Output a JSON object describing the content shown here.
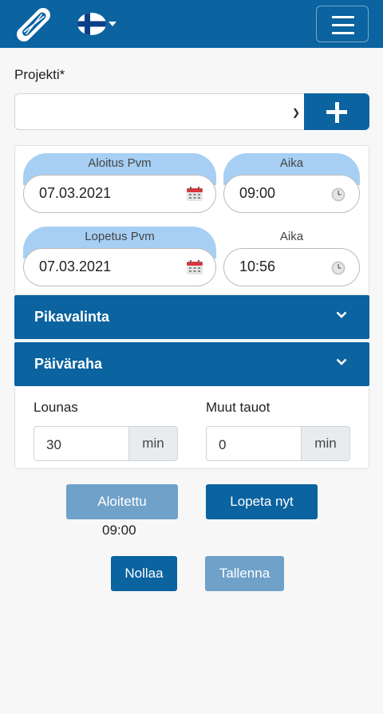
{
  "header": {
    "logo_icon": "paperclip-pencil-logo",
    "language_flag": "finland-flag",
    "menu_icon": "hamburger-icon",
    "brand_color": "#0b63a0"
  },
  "project": {
    "label": "Projekti*",
    "selected_value": "",
    "add_icon": "plus-icon"
  },
  "start": {
    "date_label": "Aloitus Pvm",
    "date_value": "07.03.2021",
    "time_label": "Aika",
    "time_value": "09:00"
  },
  "end": {
    "date_label": "Lopetus Pvm",
    "date_value": "07.03.2021",
    "time_label": "Aika",
    "time_value": "10:56"
  },
  "sections": [
    {
      "label": "Pikavalinta"
    },
    {
      "label": "Päiväraha"
    }
  ],
  "breaks": {
    "lunch_label": "Lounas",
    "lunch_value": "30",
    "lunch_unit": "min",
    "other_label": "Muut tauot",
    "other_value": "0",
    "other_unit": "min"
  },
  "actions": {
    "started_label": "Aloitettu",
    "started_time": "09:00",
    "stop_label": "Lopeta nyt",
    "reset_label": "Nollaa",
    "save_label": "Tallenna"
  },
  "colors": {
    "accent": "#0b63a0",
    "accent_light": "#6fa1c9",
    "pill_header": "#a6cff3"
  }
}
